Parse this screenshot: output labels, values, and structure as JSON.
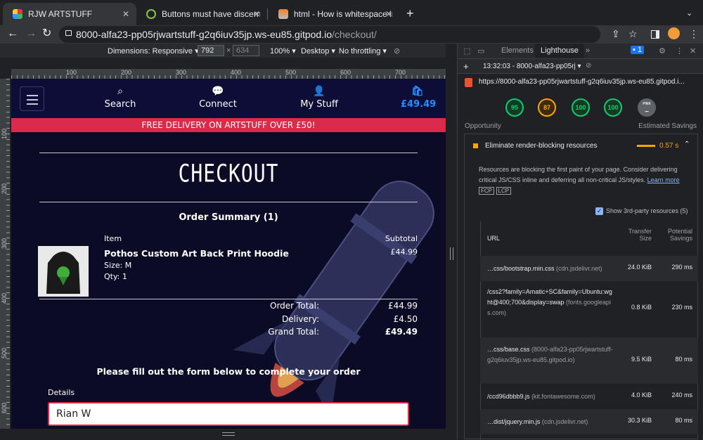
{
  "browser": {
    "tabs": [
      {
        "title": "RJW ARTSTUFF",
        "active": true
      },
      {
        "title": "Buttons must have discernible",
        "active": false
      },
      {
        "title": "html - How is whitespace in an",
        "active": false
      }
    ],
    "new_tab": "+",
    "url_host": "8000-alfa23-pp05rjwartstuff-g2q6iuv35jp.ws-eu85.gitpod.io",
    "url_path": "/checkout/"
  },
  "device_toolbar": {
    "dimensions": "Dimensions: Responsive",
    "width": "792",
    "height": "634",
    "zoom": "100%",
    "device": "Desktop",
    "throttle": "No throttling"
  },
  "ruler": {
    "h": [
      "100",
      "200",
      "300",
      "400",
      "500",
      "600",
      "700"
    ],
    "v": [
      "100",
      "200",
      "300",
      "400",
      "500",
      "600"
    ]
  },
  "site": {
    "nav": {
      "search": "Search",
      "connect": "Connect",
      "mystuff": "My Stuff",
      "bag": "£49.49"
    },
    "banner": "FREE DELIVERY ON ARTSTUFF OVER £50!",
    "title": "CHECKOUT",
    "summary": "Order Summary (1)",
    "col_item": "Item",
    "col_subtotal": "Subtotal",
    "product": {
      "name": "Pothos Custom Art Back Print Hoodie",
      "size": "Size: M",
      "qty": "Qty: 1",
      "price": "£44.99"
    },
    "totals": {
      "order_label": "Order Total:",
      "order": "£44.99",
      "delivery_label": "Delivery:",
      "delivery": "£4.50",
      "grand_label": "Grand Total:",
      "grand": "£49.49"
    },
    "form_prompt": "Please fill out the form below to complete your order",
    "details_label": "Details",
    "name_value": "Rian W"
  },
  "devtools": {
    "tabs": [
      "Elements",
      "Lighthouse"
    ],
    "issues": "1",
    "report_time": "13:32:03 - 8000-alfa23-pp05rj",
    "report_url": "https://8000-alfa23-pp05rjwartstuff-g2q6iuv35jp.ws-eu85.gitpod.i...",
    "scores": [
      "95",
      "87",
      "100",
      "100"
    ],
    "pwa": "PWA",
    "opportunity": "Opportunity",
    "estimated_savings": "Estimated Savings",
    "audit": {
      "title": "Eliminate render-blocking resources",
      "savings": "0.57 s",
      "desc": "Resources are blocking the first paint of your page. Consider delivering critical JS/CSS inline and deferring all non-critical JS/styles.",
      "learn": "Learn more",
      "tags": [
        "FCP",
        "LCP"
      ],
      "show3p": "Show 3rd-party resources (5)",
      "headers": {
        "url": "URL",
        "transfer": "Transfer Size",
        "potential": "Potential Savings"
      },
      "rows": [
        {
          "url": "…css/bootstrap.min.css",
          "domain": "(cdn.jsdelivr.net)",
          "size": "24.0 KiB",
          "savings": "290 ms"
        },
        {
          "url": "/css2?family=Amatic+SC&family=Ubuntu:wght@400;700&display=swap",
          "domain": "(fonts.googleapis.com)",
          "size": "0.8 KiB",
          "savings": "230 ms"
        },
        {
          "url": "…css/base.css",
          "domain": "(8000-alfa23-pp05rjwartstuff-g2q6iuv35jp.ws-eu85.gitpod.io)",
          "size": "9.5 KiB",
          "savings": "80 ms"
        },
        {
          "url": "/ccd96dbbb9.js",
          "domain": "(kit.fontawesome.com)",
          "size": "4.0 KiB",
          "savings": "240 ms"
        },
        {
          "url": "…dist/jquery.min.js",
          "domain": "(cdn.jsdelivr.net)",
          "size": "30.3 KiB",
          "savings": "80 ms"
        }
      ]
    }
  },
  "colors": {
    "accent": "#dc2a4b",
    "nav": "#0d0d38",
    "bag": "#1e90ff"
  }
}
